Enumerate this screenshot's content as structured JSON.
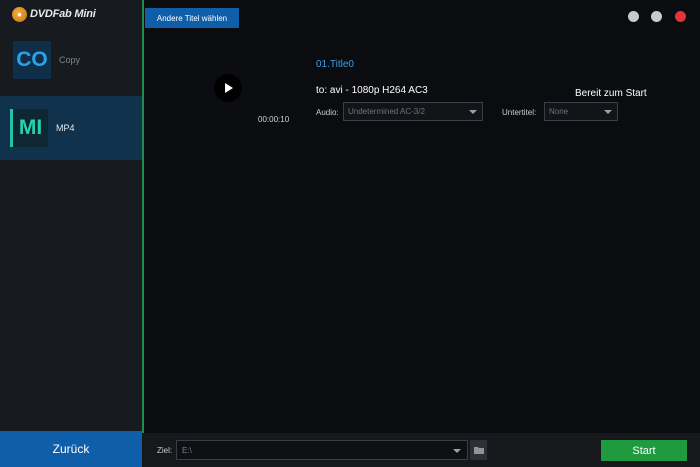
{
  "app": {
    "logo_text": "DVDFab Mini"
  },
  "sidebar": {
    "modes": [
      {
        "tile": "CO",
        "label": "Copy"
      },
      {
        "tile": "MI",
        "label": "MP4"
      }
    ],
    "back_label": "Zurück"
  },
  "header": {
    "choose_titles_label": "Andere Titel wählen"
  },
  "title": {
    "name": "01.Title0",
    "duration": "00:00:10",
    "profile": "to: avi - 1080p H264 AC3",
    "status": "Bereit zum Start",
    "audio_label": "Audio:",
    "audio_value": "Undetermined AC-3/2",
    "subtitle_label": "Untertitel:",
    "subtitle_value": "None"
  },
  "bottombar": {
    "dest_label": "Ziel:",
    "dest_value": "E:\\",
    "start_label": "Start"
  },
  "colors": {
    "accent_blue": "#0f5eaa",
    "start_green": "#1f9a3f",
    "title_blue": "#3a9ee8",
    "close_red": "#e5333a"
  }
}
